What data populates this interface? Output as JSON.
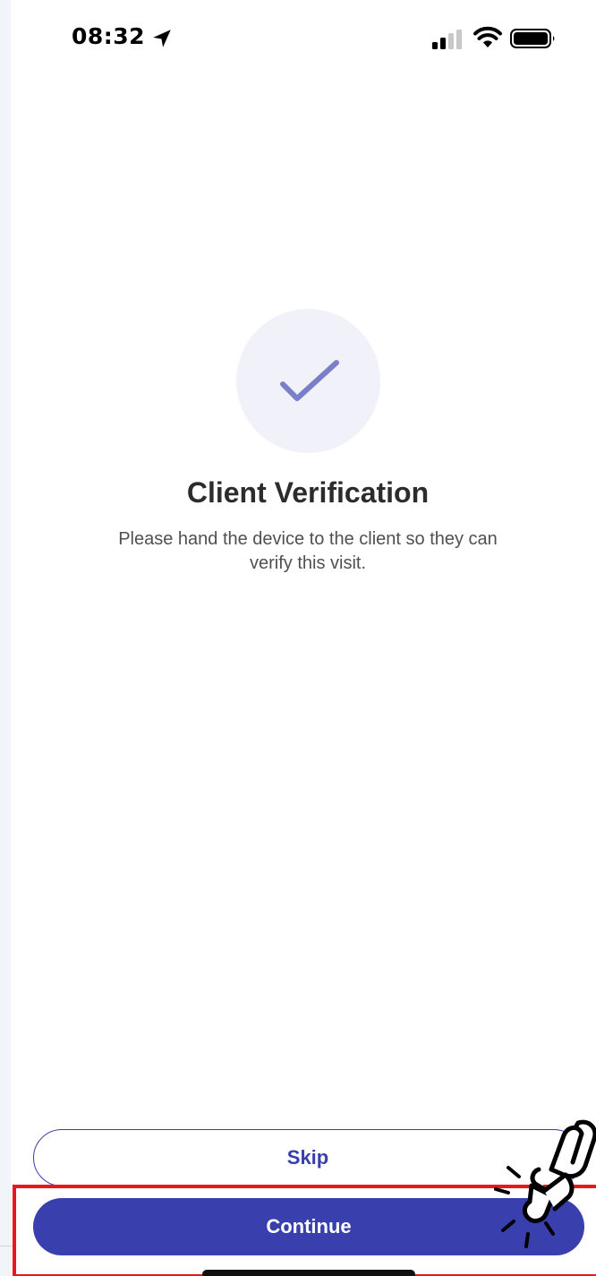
{
  "status_bar": {
    "time": "08:32",
    "icons": [
      "location-arrow-icon",
      "cellular-signal-icon",
      "wifi-icon",
      "battery-icon"
    ]
  },
  "main": {
    "icon": "checkmark-icon",
    "title": "Client Verification",
    "subtitle": "Please hand the device to the client so they can verify this visit."
  },
  "actions": {
    "skip_label": "Skip",
    "continue_label": "Continue"
  },
  "annotation": {
    "highlight_color": "#e8191c",
    "pointer_icon": "tap-hand-icon"
  },
  "colors": {
    "accent": "#3a3fae",
    "check": "#7b7fc8",
    "check_circle_bg": "#f1f1f9"
  }
}
